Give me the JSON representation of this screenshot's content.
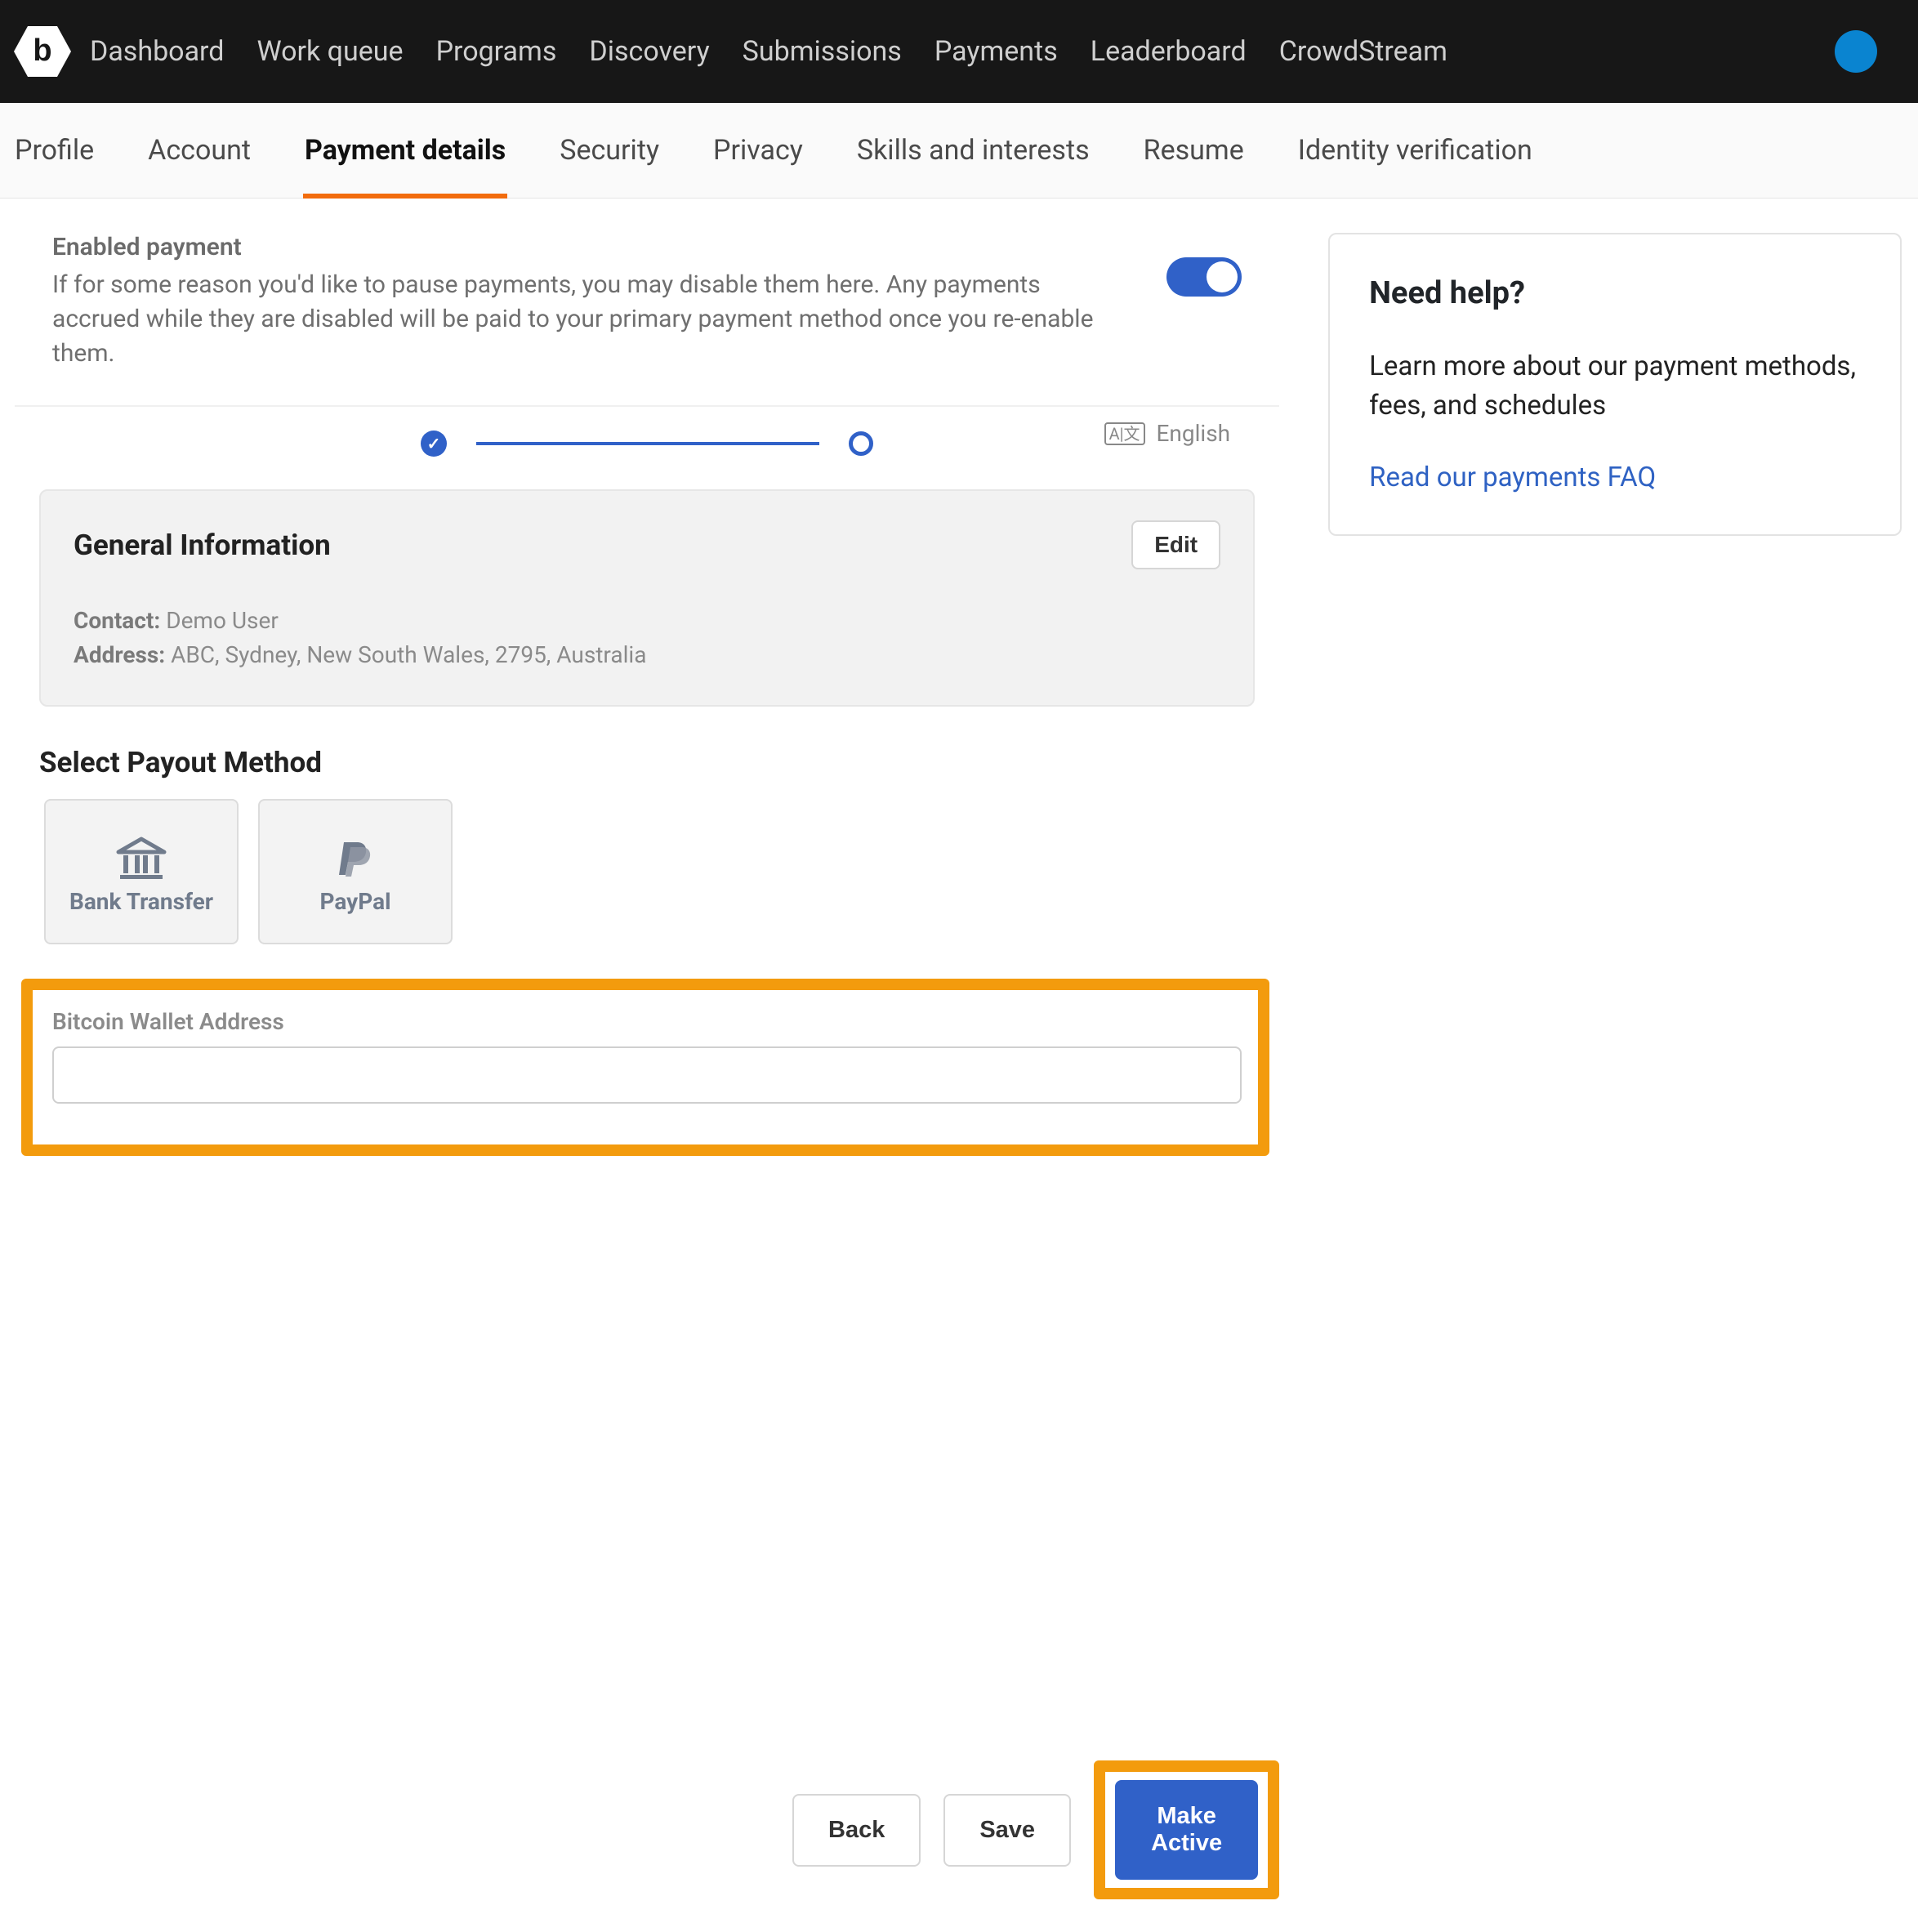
{
  "topnav": {
    "items": [
      "Dashboard",
      "Work queue",
      "Programs",
      "Discovery",
      "Submissions",
      "Payments",
      "Leaderboard",
      "CrowdStream"
    ]
  },
  "subtabs": {
    "items": [
      "Profile",
      "Account",
      "Payment details",
      "Security",
      "Privacy",
      "Skills and interests",
      "Resume",
      "Identity verification"
    ],
    "active_index": 2
  },
  "enabled": {
    "title": "Enabled payment",
    "desc": "If for some reason you'd like to pause payments, you may disable them here. Any payments accrued while they are disabled will be paid to your primary payment method once you re-enable them.",
    "on": true
  },
  "language": {
    "label": "English"
  },
  "general_info": {
    "heading": "General Information",
    "edit": "Edit",
    "contact_label": "Contact:",
    "contact_value": "Demo User",
    "address_label": "Address:",
    "address_value": "ABC, Sydney, New South Wales, 2795, Australia"
  },
  "payout": {
    "heading": "Select Payout Method",
    "methods": [
      {
        "id": "bank",
        "label": "Bank Transfer"
      },
      {
        "id": "paypal",
        "label": "PayPal"
      }
    ],
    "btc_label": "Bitcoin Wallet Address",
    "btc_value": ""
  },
  "help": {
    "title": "Need help?",
    "text": "Learn more about our payment methods, fees, and schedules",
    "link": "Read our payments FAQ"
  },
  "footer": {
    "back": "Back",
    "save": "Save",
    "make_active": "Make Active"
  },
  "colors": {
    "accent_blue": "#3061c8",
    "highlight_orange": "#f39b0d",
    "tab_underline": "#f26c0d"
  }
}
